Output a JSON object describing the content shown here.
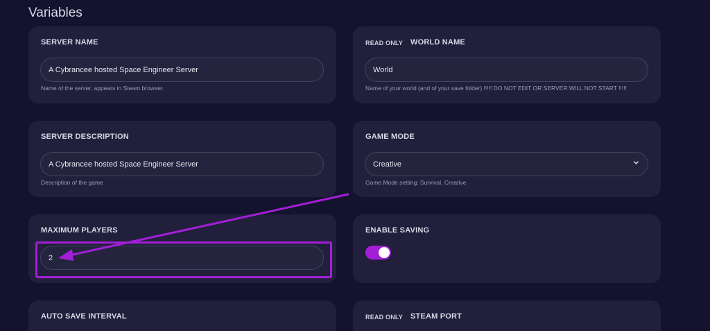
{
  "section": {
    "title": "Variables"
  },
  "cards": {
    "server_name": {
      "label": "SERVER NAME",
      "value": "A Cybrancee hosted Space Engineer Server",
      "hint": "Name of the server, appears in Steam browser."
    },
    "world_name": {
      "badge": "READ ONLY",
      "label": "WORLD NAME",
      "value": "World",
      "hint": "Name of your world (and of your save folder) !!!!! DO NOT EDIT OR SERVER WILL NOT START !!!!!"
    },
    "server_description": {
      "label": "SERVER DESCRIPTION",
      "value": "A Cybrancee hosted Space Engineer Server",
      "hint": "Description of the game"
    },
    "game_mode": {
      "label": "GAME MODE",
      "value": "Creative",
      "hint": "Game Mode setting: Survival, Creative"
    },
    "maximum_players": {
      "label": "MAXIMUM PLAYERS",
      "value": "2"
    },
    "enable_saving": {
      "label": "ENABLE SAVING",
      "enabled": true
    },
    "auto_save_interval": {
      "label": "AUTO SAVE INTERVAL"
    },
    "steam_port": {
      "badge": "READ ONLY",
      "label": "STEAM PORT"
    }
  },
  "icons": {
    "dropdown": "chevron-down-icon"
  },
  "colors": {
    "background": "#13122f",
    "card": "#211f3b",
    "accent": "#a21fd6"
  }
}
